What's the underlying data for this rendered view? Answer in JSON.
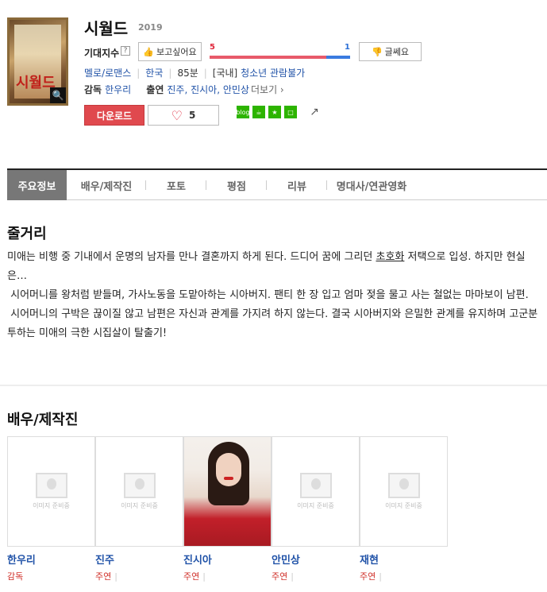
{
  "movie": {
    "title": "시월드",
    "year": "2019",
    "poster_title": "시월드",
    "expect_label": "기대지수",
    "help_mark": "?",
    "want_label": "보고싶어요",
    "want_count": "5",
    "meh_count": "1",
    "meh_label": "글쎄요",
    "genre": "멜로/로맨스",
    "country": "한국",
    "runtime": "85분",
    "rating_prefix": "[국내]",
    "rating": "청소년 관람불가",
    "director_label": "감독",
    "director": "한우리",
    "cast_label": "출연",
    "cast_names": "진주, 진시아, 안민상",
    "more_label": "더보기",
    "download_label": "다운로드",
    "like_count": "5",
    "want_ratio": 0.83
  },
  "share": {
    "icons": [
      "blog-icon",
      "cafe-icon",
      "star-icon",
      "square-icon",
      "share-icon"
    ],
    "blog_text": "blog"
  },
  "tabs": [
    {
      "label": "주요정보"
    },
    {
      "label": "배우/제작진"
    },
    {
      "label": "포토"
    },
    {
      "label": "평점"
    },
    {
      "label": "리뷰"
    },
    {
      "label": "명대사/연관영화"
    }
  ],
  "synopsis": {
    "heading": "줄거리",
    "p1a": "미애는 비행 중 기내에서 운명의 남자를 만나 결혼까지 하게 된다. 드디어 꿈에 그리던 ",
    "p1b": "초호화",
    "p1c": " 저택으로 입성. 하지만 현실은…",
    "p2": " 시어머니를 왕처럼 받들며, 가사노동을 도맡아하는 시아버지. 팬티 한 장 입고 엄마 젖을 물고 사는 철없는 마마보이 남편.",
    "p3": " 시어머니의 구박은 끊이질 않고 남편은 자신과 관계를 가지려 하지 않는다. 결국 시아버지와 은밀한 관계를 유지하며 고군분투하는 미애의 극한 시집살이 탈출기!"
  },
  "cast_section": {
    "heading": "배우/제작진",
    "placeholder_text": "이미지 준비중",
    "members": [
      {
        "name": "한우리",
        "role": "감독"
      },
      {
        "name": "진주",
        "role": "주연"
      },
      {
        "name": "진시아",
        "role": "주연"
      },
      {
        "name": "안민상",
        "role": "주연"
      },
      {
        "name": "재현",
        "role": "주연"
      }
    ]
  }
}
